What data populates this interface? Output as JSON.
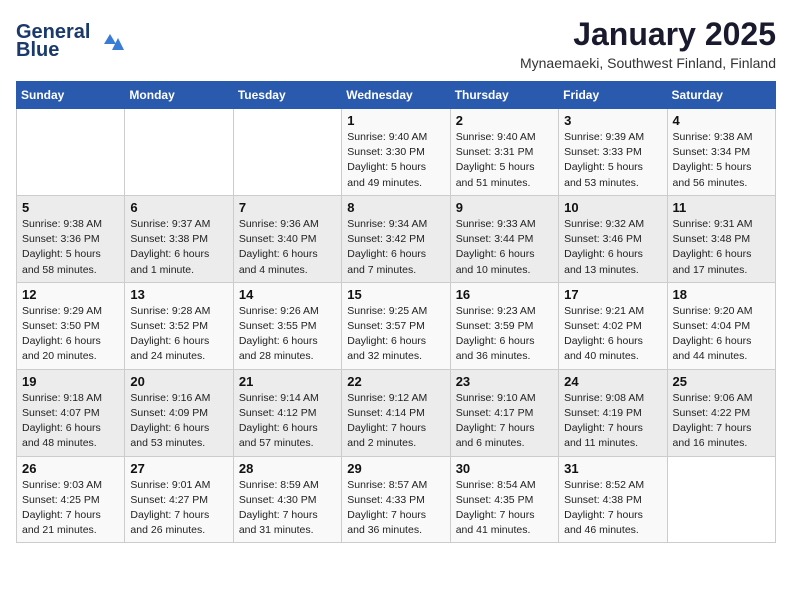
{
  "header": {
    "logo_line1": "General",
    "logo_line2": "Blue",
    "title": "January 2025",
    "subtitle": "Mynaemaeki, Southwest Finland, Finland"
  },
  "weekdays": [
    "Sunday",
    "Monday",
    "Tuesday",
    "Wednesday",
    "Thursday",
    "Friday",
    "Saturday"
  ],
  "weeks": [
    [
      {
        "day": "",
        "detail": ""
      },
      {
        "day": "",
        "detail": ""
      },
      {
        "day": "",
        "detail": ""
      },
      {
        "day": "1",
        "detail": "Sunrise: 9:40 AM\nSunset: 3:30 PM\nDaylight: 5 hours\nand 49 minutes."
      },
      {
        "day": "2",
        "detail": "Sunrise: 9:40 AM\nSunset: 3:31 PM\nDaylight: 5 hours\nand 51 minutes."
      },
      {
        "day": "3",
        "detail": "Sunrise: 9:39 AM\nSunset: 3:33 PM\nDaylight: 5 hours\nand 53 minutes."
      },
      {
        "day": "4",
        "detail": "Sunrise: 9:38 AM\nSunset: 3:34 PM\nDaylight: 5 hours\nand 56 minutes."
      }
    ],
    [
      {
        "day": "5",
        "detail": "Sunrise: 9:38 AM\nSunset: 3:36 PM\nDaylight: 5 hours\nand 58 minutes."
      },
      {
        "day": "6",
        "detail": "Sunrise: 9:37 AM\nSunset: 3:38 PM\nDaylight: 6 hours\nand 1 minute."
      },
      {
        "day": "7",
        "detail": "Sunrise: 9:36 AM\nSunset: 3:40 PM\nDaylight: 6 hours\nand 4 minutes."
      },
      {
        "day": "8",
        "detail": "Sunrise: 9:34 AM\nSunset: 3:42 PM\nDaylight: 6 hours\nand 7 minutes."
      },
      {
        "day": "9",
        "detail": "Sunrise: 9:33 AM\nSunset: 3:44 PM\nDaylight: 6 hours\nand 10 minutes."
      },
      {
        "day": "10",
        "detail": "Sunrise: 9:32 AM\nSunset: 3:46 PM\nDaylight: 6 hours\nand 13 minutes."
      },
      {
        "day": "11",
        "detail": "Sunrise: 9:31 AM\nSunset: 3:48 PM\nDaylight: 6 hours\nand 17 minutes."
      }
    ],
    [
      {
        "day": "12",
        "detail": "Sunrise: 9:29 AM\nSunset: 3:50 PM\nDaylight: 6 hours\nand 20 minutes."
      },
      {
        "day": "13",
        "detail": "Sunrise: 9:28 AM\nSunset: 3:52 PM\nDaylight: 6 hours\nand 24 minutes."
      },
      {
        "day": "14",
        "detail": "Sunrise: 9:26 AM\nSunset: 3:55 PM\nDaylight: 6 hours\nand 28 minutes."
      },
      {
        "day": "15",
        "detail": "Sunrise: 9:25 AM\nSunset: 3:57 PM\nDaylight: 6 hours\nand 32 minutes."
      },
      {
        "day": "16",
        "detail": "Sunrise: 9:23 AM\nSunset: 3:59 PM\nDaylight: 6 hours\nand 36 minutes."
      },
      {
        "day": "17",
        "detail": "Sunrise: 9:21 AM\nSunset: 4:02 PM\nDaylight: 6 hours\nand 40 minutes."
      },
      {
        "day": "18",
        "detail": "Sunrise: 9:20 AM\nSunset: 4:04 PM\nDaylight: 6 hours\nand 44 minutes."
      }
    ],
    [
      {
        "day": "19",
        "detail": "Sunrise: 9:18 AM\nSunset: 4:07 PM\nDaylight: 6 hours\nand 48 minutes."
      },
      {
        "day": "20",
        "detail": "Sunrise: 9:16 AM\nSunset: 4:09 PM\nDaylight: 6 hours\nand 53 minutes."
      },
      {
        "day": "21",
        "detail": "Sunrise: 9:14 AM\nSunset: 4:12 PM\nDaylight: 6 hours\nand 57 minutes."
      },
      {
        "day": "22",
        "detail": "Sunrise: 9:12 AM\nSunset: 4:14 PM\nDaylight: 7 hours\nand 2 minutes."
      },
      {
        "day": "23",
        "detail": "Sunrise: 9:10 AM\nSunset: 4:17 PM\nDaylight: 7 hours\nand 6 minutes."
      },
      {
        "day": "24",
        "detail": "Sunrise: 9:08 AM\nSunset: 4:19 PM\nDaylight: 7 hours\nand 11 minutes."
      },
      {
        "day": "25",
        "detail": "Sunrise: 9:06 AM\nSunset: 4:22 PM\nDaylight: 7 hours\nand 16 minutes."
      }
    ],
    [
      {
        "day": "26",
        "detail": "Sunrise: 9:03 AM\nSunset: 4:25 PM\nDaylight: 7 hours\nand 21 minutes."
      },
      {
        "day": "27",
        "detail": "Sunrise: 9:01 AM\nSunset: 4:27 PM\nDaylight: 7 hours\nand 26 minutes."
      },
      {
        "day": "28",
        "detail": "Sunrise: 8:59 AM\nSunset: 4:30 PM\nDaylight: 7 hours\nand 31 minutes."
      },
      {
        "day": "29",
        "detail": "Sunrise: 8:57 AM\nSunset: 4:33 PM\nDaylight: 7 hours\nand 36 minutes."
      },
      {
        "day": "30",
        "detail": "Sunrise: 8:54 AM\nSunset: 4:35 PM\nDaylight: 7 hours\nand 41 minutes."
      },
      {
        "day": "31",
        "detail": "Sunrise: 8:52 AM\nSunset: 4:38 PM\nDaylight: 7 hours\nand 46 minutes."
      },
      {
        "day": "",
        "detail": ""
      }
    ]
  ]
}
